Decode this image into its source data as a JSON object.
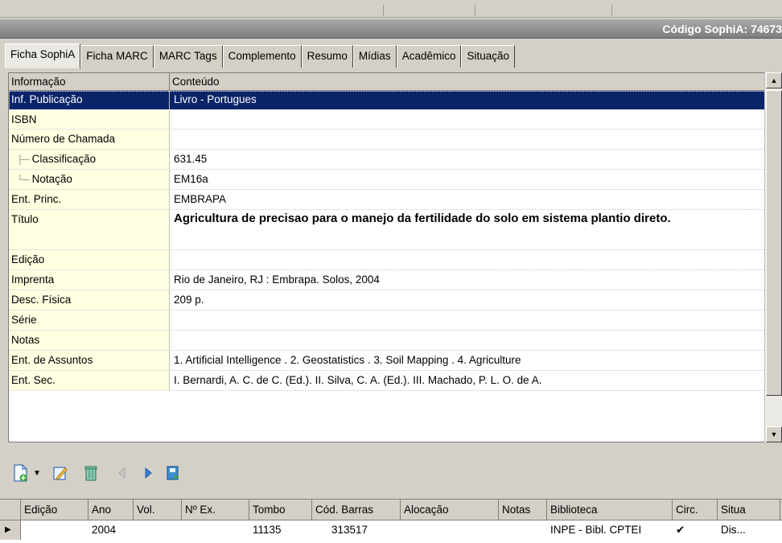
{
  "header": {
    "codigo": "Código SophiA: 74673"
  },
  "tabs": [
    "Ficha SophiA",
    "Ficha MARC",
    "MARC Tags",
    "Complemento",
    "Resumo",
    "Mídias",
    "Acadêmico",
    "Situação"
  ],
  "grid": {
    "col_info": "Informação",
    "col_content": "Conteúdo",
    "rows": [
      {
        "label": "Inf. Publicação",
        "value": "Livro - Portugues"
      },
      {
        "label": "ISBN",
        "value": ""
      },
      {
        "label": "Número de Chamada",
        "value": ""
      },
      {
        "label": "Classificação",
        "value": "631.45"
      },
      {
        "label": "Notação",
        "value": "EM16a"
      },
      {
        "label": "Ent. Princ.",
        "value": "EMBRAPA"
      },
      {
        "label": "Título",
        "value": "Agricultura de precisao para o manejo da fertilidade do solo em sistema plantio direto."
      },
      {
        "label": "Edição",
        "value": ""
      },
      {
        "label": "Imprenta",
        "value": "Rio de Janeiro, RJ : Embrapa. Solos, 2004"
      },
      {
        "label": "Desc. Física",
        "value": "209 p."
      },
      {
        "label": "Série",
        "value": ""
      },
      {
        "label": "Notas",
        "value": ""
      },
      {
        "label": "Ent. de Assuntos",
        "value": "1. Artificial Intelligence . 2. Geostatistics . 3. Soil Mapping . 4. Agriculture"
      },
      {
        "label": "Ent. Sec.",
        "value": "I. Bernardi, A. C. de C. (Ed.). II. Silva, C. A. (Ed.). III. Machado, P. L. O. de A."
      }
    ]
  },
  "toolbar": {
    "icons": [
      "new-document-icon",
      "dropdown-arrow-icon",
      "edit-icon",
      "delete-icon",
      "previous-icon",
      "next-icon",
      "save-icon"
    ]
  },
  "exemplares": {
    "columns": [
      "Edição",
      "Ano",
      "Vol.",
      "Nº Ex.",
      "Tombo",
      "Cód. Barras",
      "Alocação",
      "Notas",
      "Biblioteca",
      "Circ.",
      "Situa"
    ],
    "rows": [
      {
        "edicao": "",
        "ano": "2004",
        "vol": "",
        "nex": "",
        "tombo": "11135",
        "cod": "313517",
        "alocacao": "",
        "notas": "",
        "biblioteca": "INPE - Bibl. CPTEI",
        "circ": "✔",
        "situacao": "Dis..."
      }
    ]
  },
  "colors": {
    "selection": "#0a246a",
    "label_bg": "#ffffe1",
    "face": "#d4d0c8"
  }
}
